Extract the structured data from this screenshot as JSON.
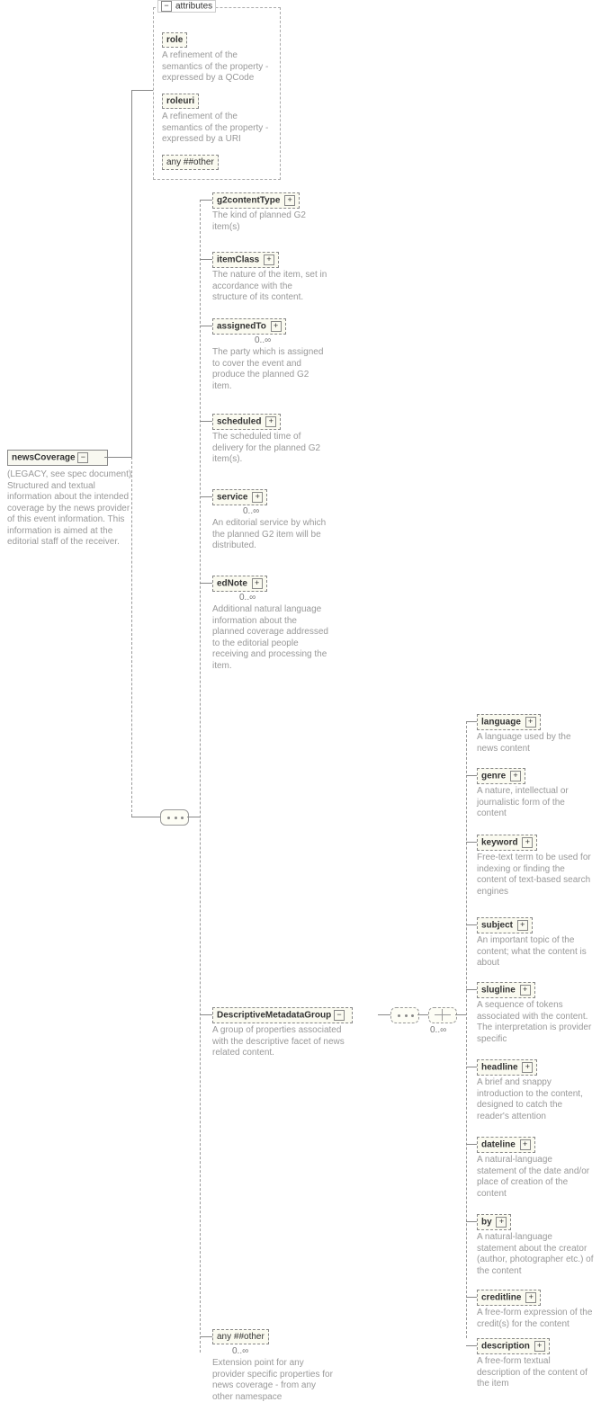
{
  "root": {
    "name": "newsCoverage",
    "desc": "(LEGACY, see spec document) Structured and textual information about the intended coverage by the news provider of this event information. This information is aimed at the editorial staff of the receiver."
  },
  "attributes": {
    "header": "attributes",
    "collapse": "−",
    "items": [
      {
        "name": "role",
        "desc": "A refinement of the semantics of the property - expressed by a QCode"
      },
      {
        "name": "roleuri",
        "desc": "A refinement of the semantics of the property - expressed by a URI"
      }
    ],
    "wildcard": "any ##other"
  },
  "children": [
    {
      "name": "g2contentType",
      "desc": "The kind of planned G2 item(s)"
    },
    {
      "name": "itemClass",
      "desc": "The nature of the item, set in accordance with the structure of its content."
    },
    {
      "name": "assignedTo",
      "desc": "The party which is assigned to cover the event and produce the planned G2 item.",
      "occ": "0..∞"
    },
    {
      "name": "scheduled",
      "desc": "The scheduled time of delivery for the planned G2 item(s)."
    },
    {
      "name": "service",
      "desc": "An editorial service by which the planned G2 item will be distributed.",
      "occ": "0..∞"
    },
    {
      "name": "edNote",
      "desc": "Additional natural language information about the planned coverage addressed to the editorial people receiving and processing the item.",
      "occ": "0..∞"
    }
  ],
  "dmg": {
    "name": "DescriptiveMetadataGroup",
    "desc": "A group of properties associated with the descriptive facet of news related content.",
    "occ": "0..∞"
  },
  "dmgChildren": [
    {
      "name": "language",
      "desc": "A language used by the news content"
    },
    {
      "name": "genre",
      "desc": "A nature, intellectual or journalistic form of the content"
    },
    {
      "name": "keyword",
      "desc": "Free-text term to be used for indexing or finding the content of text-based search engines"
    },
    {
      "name": "subject",
      "desc": "An important topic of the content; what the content is about"
    },
    {
      "name": "slugline",
      "desc": "A sequence of tokens associated with the content. The interpretation is provider specific"
    },
    {
      "name": "headline",
      "desc": "A brief and snappy introduction to the content, designed to catch the reader's attention"
    },
    {
      "name": "dateline",
      "desc": "A natural-language statement of the date and/or place of creation of the content"
    },
    {
      "name": "by",
      "desc": "A natural-language statement about the creator (author, photographer etc.) of the content"
    },
    {
      "name": "creditline",
      "desc": "A free-form expression of the credit(s) for the content"
    },
    {
      "name": "description",
      "desc": "A free-form textual description of the content of the item"
    }
  ],
  "tail": {
    "name": "any ##other",
    "desc": "Extension point for any provider specific properties for news coverage - from any other namespace",
    "occ": "0..∞"
  },
  "plus": "+"
}
